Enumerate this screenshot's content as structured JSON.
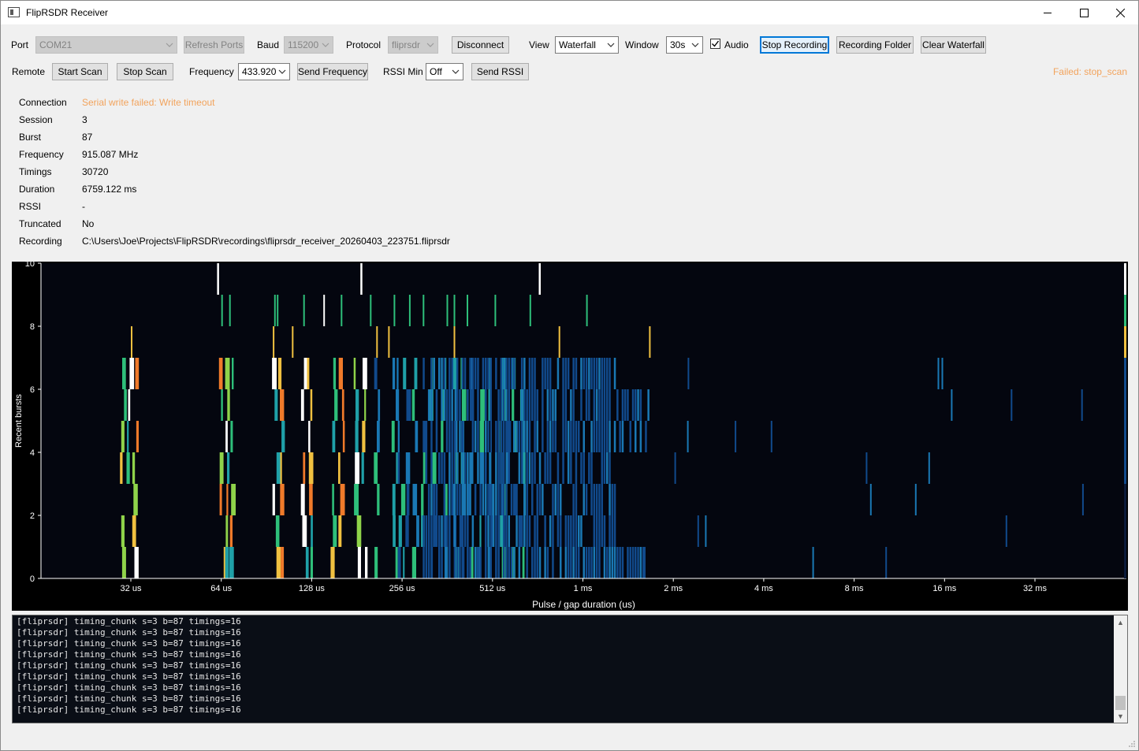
{
  "window": {
    "title": "FlipRSDR Receiver"
  },
  "toolbar": {
    "port_label": "Port",
    "port_value": "COM21",
    "refresh_ports": "Refresh Ports",
    "baud_label": "Baud",
    "baud_value": "115200",
    "protocol_label": "Protocol",
    "protocol_value": "fliprsdr",
    "disconnect": "Disconnect",
    "view_label": "View",
    "view_value": "Waterfall",
    "window_label": "Window",
    "window_value": "30s",
    "audio_label": "Audio",
    "audio_checked": true,
    "stop_recording": "Stop Recording",
    "recording_folder": "Recording Folder",
    "clear_waterfall": "Clear Waterfall"
  },
  "remote": {
    "label": "Remote",
    "start_scan": "Start Scan",
    "stop_scan": "Stop Scan",
    "frequency_label": "Frequency",
    "frequency_value": "433.920",
    "send_frequency": "Send Frequency",
    "rssi_min_label": "RSSI Min",
    "rssi_min_value": "Off",
    "send_rssi": "Send RSSI",
    "status": "Failed: stop_scan"
  },
  "info": [
    {
      "key": "Connection",
      "value": "Serial write failed: Write timeout",
      "warn": true
    },
    {
      "key": "Session",
      "value": "3"
    },
    {
      "key": "Burst",
      "value": "87"
    },
    {
      "key": "Frequency",
      "value": "915.087 MHz"
    },
    {
      "key": "Timings",
      "value": "30720"
    },
    {
      "key": "Duration",
      "value": "6759.122 ms"
    },
    {
      "key": "RSSI",
      "value": "-"
    },
    {
      "key": "Truncated",
      "value": "No"
    },
    {
      "key": "Recording",
      "value": "C:\\Users\\Joe\\Projects\\FlipRSDR\\recordings\\fliprsdr_receiver_20260403_223751.fliprsdr"
    }
  ],
  "chart_data": {
    "type": "heatmap",
    "xlabel": "Pulse / gap duration (us)",
    "ylabel": "Recent bursts",
    "x_scale": "log2",
    "x_ticks": [
      "32 us",
      "64 us",
      "128 us",
      "256 us",
      "512 us",
      "1 ms",
      "2 ms",
      "4 ms",
      "8 ms",
      "16 ms",
      "32 ms"
    ],
    "y_ticks": [
      "0",
      "2",
      "4",
      "6",
      "8",
      "10"
    ],
    "ylim": [
      0,
      10
    ],
    "colormap": [
      "#0a1a3a",
      "#114a8c",
      "#1a78b4",
      "#1fa0a8",
      "#2ebf7a",
      "#8fd34a",
      "#f0c040",
      "#f07a2a",
      "#ffffff"
    ],
    "background": "#04060f"
  },
  "console": {
    "lines": [
      "[fliprsdr] timing_chunk s=3 b=87 timings=16",
      "[fliprsdr] timing_chunk s=3 b=87 timings=16",
      "[fliprsdr] timing_chunk s=3 b=87 timings=16",
      "[fliprsdr] timing_chunk s=3 b=87 timings=16",
      "[fliprsdr] timing_chunk s=3 b=87 timings=16",
      "[fliprsdr] timing_chunk s=3 b=87 timings=16",
      "[fliprsdr] timing_chunk s=3 b=87 timings=16",
      "[fliprsdr] timing_chunk s=3 b=87 timings=16",
      "[fliprsdr] timing_chunk s=3 b=87 timings=16"
    ]
  }
}
